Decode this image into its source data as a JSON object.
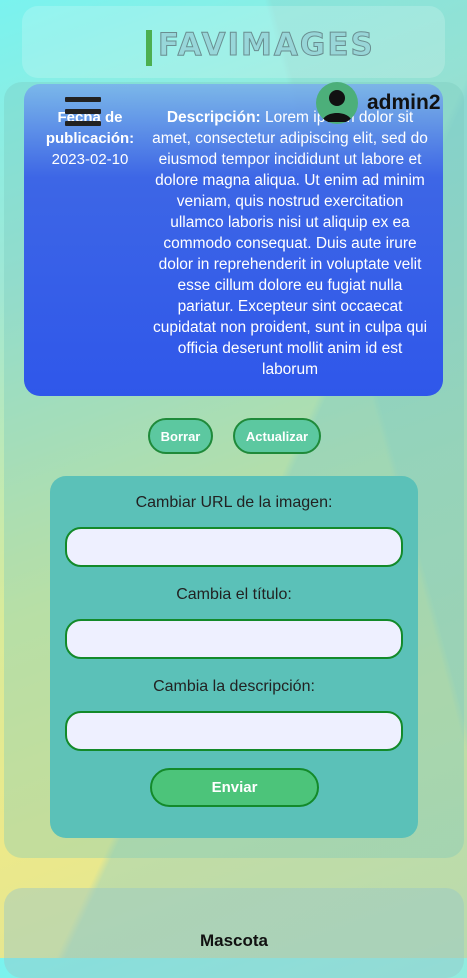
{
  "header": {
    "site_title": "FAVIMAGES",
    "username": "admin2"
  },
  "icons": {
    "menu": "hamburger-menu-icon",
    "user": "user-avatar-icon"
  },
  "image_card": {
    "date_label": "Fecha de publicación:",
    "date_value": "2023-02-10",
    "description_label": "Descripción:",
    "description_text": "Lorem ipsum dolor sit amet, consectetur adipiscing elit, sed do eiusmod tempor incididunt ut labore et dolore magna aliqua. Ut enim ad minim veniam, quis nostrud exercitation ullamco laboris nisi ut aliquip ex ea commodo consequat. Duis aute irure dolor in reprehenderit in voluptate velit esse cillum dolore eu fugiat nulla pariatur. Excepteur sint occaecat cupidatat non proident, sunt in culpa qui officia deserunt mollit anim id est laborum"
  },
  "actions": {
    "delete_label": "Borrar",
    "update_label": "Actualizar"
  },
  "form": {
    "url_label": "Cambiar URL de la imagen:",
    "url_value": "",
    "title_label": "Cambia el título:",
    "title_value": "",
    "description_label": "Cambia la descripción:",
    "description_value": "",
    "submit_label": "Enviar"
  },
  "next_card": {
    "title": "Mascota"
  },
  "colors": {
    "card_blue": "#2f57ea",
    "accent_green": "#4caf50",
    "form_teal": "#5bc1b8"
  }
}
